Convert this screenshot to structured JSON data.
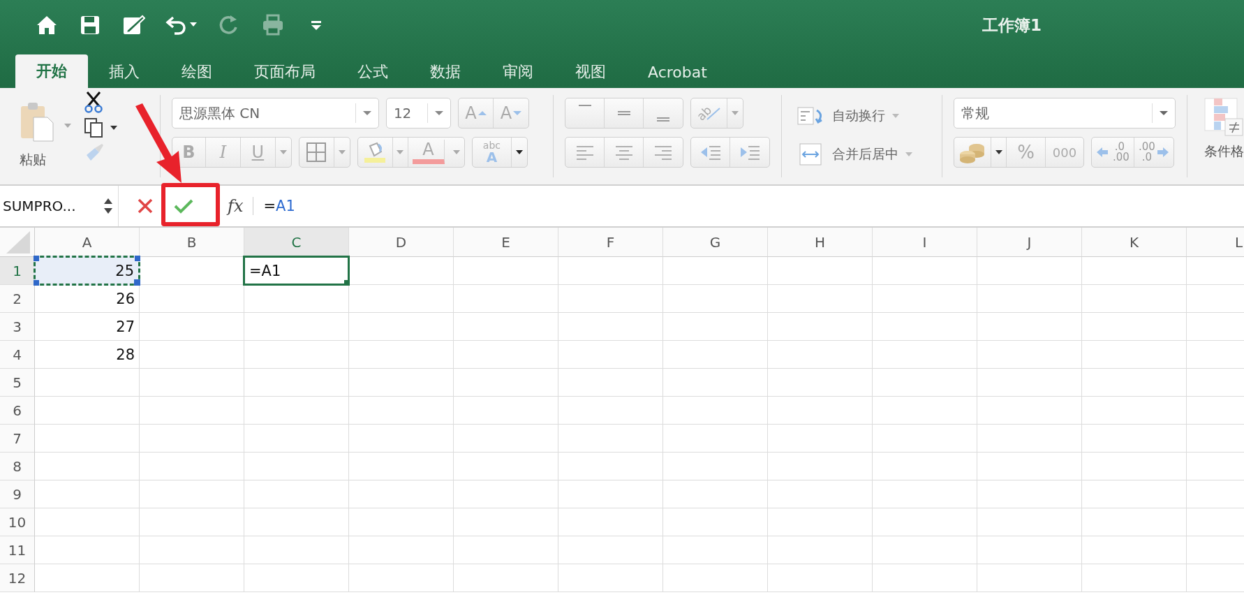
{
  "quick_access": [
    {
      "kind": "home",
      "disabled": false
    },
    {
      "kind": "save",
      "disabled": false
    },
    {
      "kind": "edit",
      "disabled": false
    },
    {
      "kind": "undo",
      "disabled": false
    },
    {
      "kind": "redo",
      "disabled": true
    },
    {
      "kind": "print",
      "disabled": true
    },
    {
      "kind": "customize",
      "disabled": false
    }
  ],
  "window": {
    "title": "工作簿1"
  },
  "tabs": [
    {
      "label": "开始",
      "selected": true
    },
    {
      "label": "插入",
      "selected": false
    },
    {
      "label": "绘图",
      "selected": false
    },
    {
      "label": "页面布局",
      "selected": false
    },
    {
      "label": "公式",
      "selected": false
    },
    {
      "label": "数据",
      "selected": false
    },
    {
      "label": "审阅",
      "selected": false
    },
    {
      "label": "视图",
      "selected": false
    },
    {
      "label": "Acrobat",
      "selected": false
    }
  ],
  "ribbon": {
    "paste_label": "粘贴",
    "font_name": "思源黑体 CN",
    "font_size": "12",
    "grow_font": "A",
    "shrink_font": "A",
    "bold": "B",
    "italic": "I",
    "underline": "U",
    "font_color": "A",
    "phonetic_top": "abc",
    "phonetic_bottom": "A",
    "orientation": "ab",
    "wrap_text": "自动换行",
    "merge_center": "合并后居中",
    "number_format": "常规",
    "percent": "%",
    "thousands": "000",
    "increase_decimal": [
      ".0",
      ".00"
    ],
    "decrease_decimal": [
      ".00",
      ".0"
    ],
    "conditional_format": "条件格"
  },
  "formula_bar": {
    "name_box": "SUMPRO...",
    "fx": "fx",
    "prefix": "=",
    "reference": "A1"
  },
  "sheet": {
    "columns": [
      {
        "label": "A",
        "selected": false
      },
      {
        "label": "B",
        "selected": false
      },
      {
        "label": "C",
        "selected": true
      },
      {
        "label": "D",
        "selected": false
      },
      {
        "label": "E",
        "selected": false
      },
      {
        "label": "F",
        "selected": false
      },
      {
        "label": "G",
        "selected": false
      },
      {
        "label": "H",
        "selected": false
      },
      {
        "label": "I",
        "selected": false
      },
      {
        "label": "J",
        "selected": false
      },
      {
        "label": "K",
        "selected": false
      },
      {
        "label": "L",
        "selected": false
      }
    ],
    "rows": [
      {
        "label": "1",
        "selected": true,
        "cells": {
          "a": {
            "value": "25",
            "referenced": true
          },
          "c": {
            "value": "=A1",
            "active": true
          }
        }
      },
      {
        "label": "2",
        "selected": false,
        "cells": {
          "a": {
            "value": "26"
          }
        }
      },
      {
        "label": "3",
        "selected": false,
        "cells": {
          "a": {
            "value": "27"
          }
        }
      },
      {
        "label": "4",
        "selected": false,
        "cells": {
          "a": {
            "value": "28"
          }
        }
      },
      {
        "label": "5",
        "selected": false,
        "cells": {}
      },
      {
        "label": "6",
        "selected": false,
        "cells": {}
      },
      {
        "label": "7",
        "selected": false,
        "cells": {}
      },
      {
        "label": "8",
        "selected": false,
        "cells": {}
      },
      {
        "label": "9",
        "selected": false,
        "cells": {}
      },
      {
        "label": "10",
        "selected": false,
        "cells": {}
      },
      {
        "label": "11",
        "selected": false,
        "cells": {}
      },
      {
        "label": "12",
        "selected": false,
        "cells": {}
      }
    ]
  }
}
